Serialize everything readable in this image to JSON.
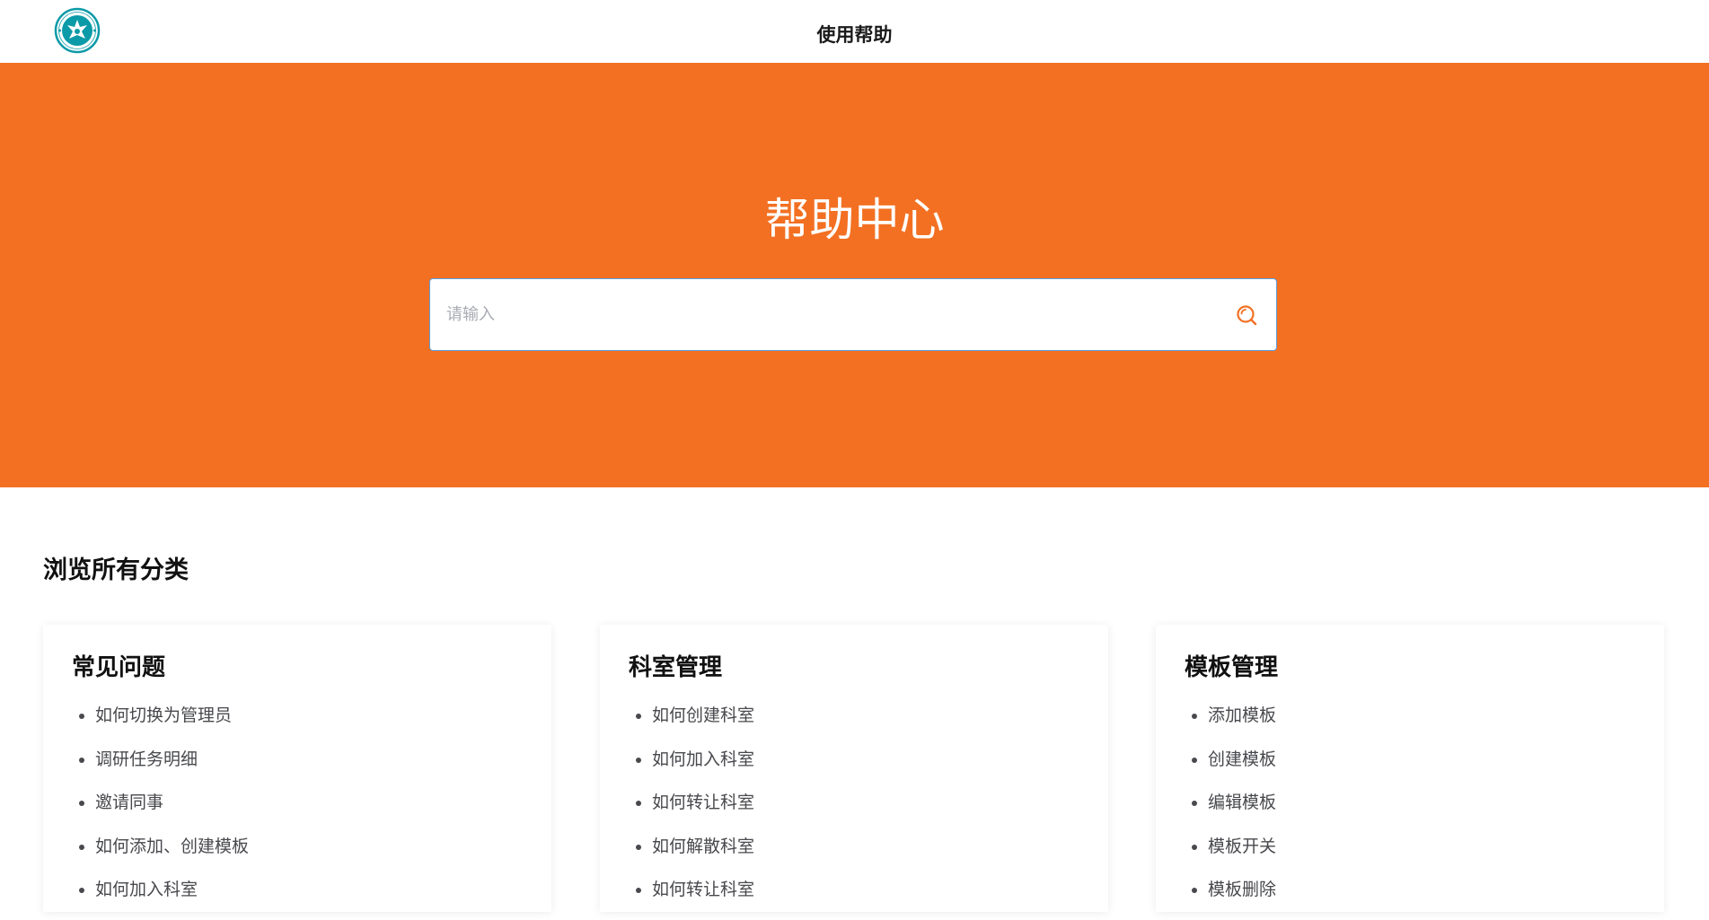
{
  "header": {
    "title": "使用帮助",
    "logo_icon": "school-emblem-icon",
    "logo_color": "#0b9aa8"
  },
  "hero": {
    "title": "帮助中心",
    "background": "#f37022",
    "search": {
      "placeholder": "请输入",
      "value": "",
      "icon": "search-icon"
    }
  },
  "categories": {
    "title": "浏览所有分类",
    "cards": [
      {
        "title": "常见问题",
        "items": [
          "如何切换为管理员",
          "调研任务明细",
          "邀请同事",
          "如何添加、创建模板",
          "如何加入科室"
        ]
      },
      {
        "title": "科室管理",
        "items": [
          "如何创建科室",
          "如何加入科室",
          "如何转让科室",
          "如何解散科室",
          "如何转让科室"
        ]
      },
      {
        "title": "模板管理",
        "items": [
          "添加模板",
          "创建模板",
          "编辑模板",
          "模板开关",
          "模板删除"
        ]
      }
    ]
  }
}
